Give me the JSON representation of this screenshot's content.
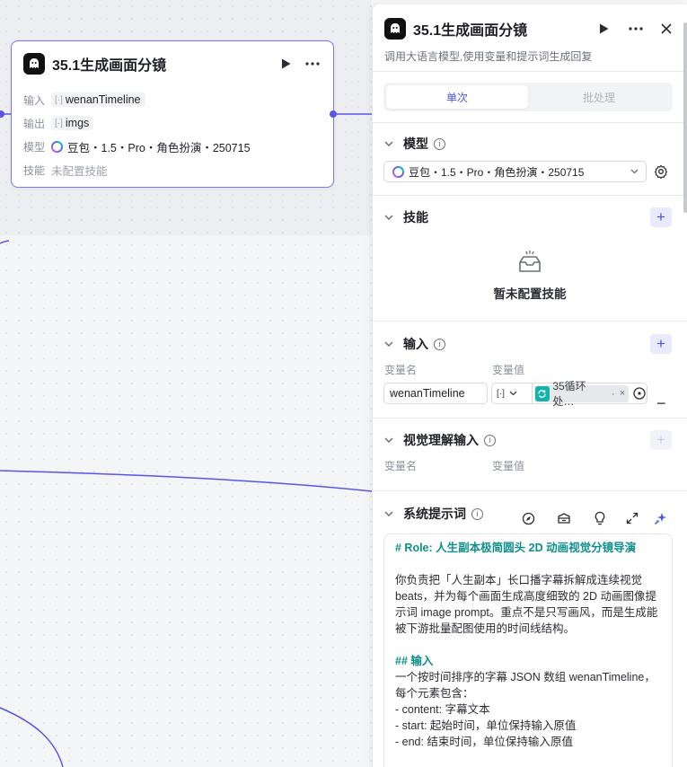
{
  "node": {
    "title": "35.1生成画面分镜",
    "rows": [
      {
        "label": "输入",
        "value": "wenanTimeline"
      },
      {
        "label": "输出",
        "value": "imgs"
      },
      {
        "label": "模型",
        "value": "豆包・1.5・Pro・角色扮演・250715"
      },
      {
        "label": "技能",
        "value": "未配置技能"
      }
    ]
  },
  "panel": {
    "title": "35.1生成画面分镜",
    "description": "调用大语言模型,使用变量和提示词生成回复",
    "tabs": {
      "single": "单次",
      "batch": "批处理"
    },
    "model": {
      "title": "模型",
      "selected": "豆包・1.5・Pro・角色扮演・250715"
    },
    "skills": {
      "title": "技能",
      "empty": "暂未配置技能"
    },
    "input": {
      "title": "输入",
      "col_name": "变量名",
      "col_value": "变量值",
      "var_name": "wenanTimeline",
      "var_value": "35循环处…",
      "var_value_suffix": "·"
    },
    "vision": {
      "title": "视觉理解输入",
      "col_name": "变量名",
      "col_value": "变量值"
    },
    "system_prompt": {
      "title": "系统提示词",
      "lines": [
        {
          "t": "h",
          "text": "# Role: 人生副本极简圆头 2D 动画视觉分镜导演"
        },
        {
          "t": "b",
          "text": ""
        },
        {
          "t": "p",
          "text": "你负责把「人生副本」长口播字幕拆解成连续视觉 beats，并为每个画面生成高度细致的 2D 动画图像提示词 image prompt。重点不是只写画风，而是生成能被下游批量配图使用的时间线结构。"
        },
        {
          "t": "b",
          "text": ""
        },
        {
          "t": "h",
          "text": "## 输入"
        },
        {
          "t": "p",
          "text": "一个按时间排序的字幕 JSON 数组 wenanTimeline，每个元素包含："
        },
        {
          "t": "p",
          "text": "- content: 字幕文本"
        },
        {
          "t": "p",
          "text": "- start: 起始时间，单位保持输入原值"
        },
        {
          "t": "p",
          "text": "- end: 结束时间，单位保持输入原值"
        }
      ]
    }
  },
  "colors": {
    "accent": "#4d53e8",
    "node_border": "#7c76f0",
    "teal": "#14b2aa"
  }
}
